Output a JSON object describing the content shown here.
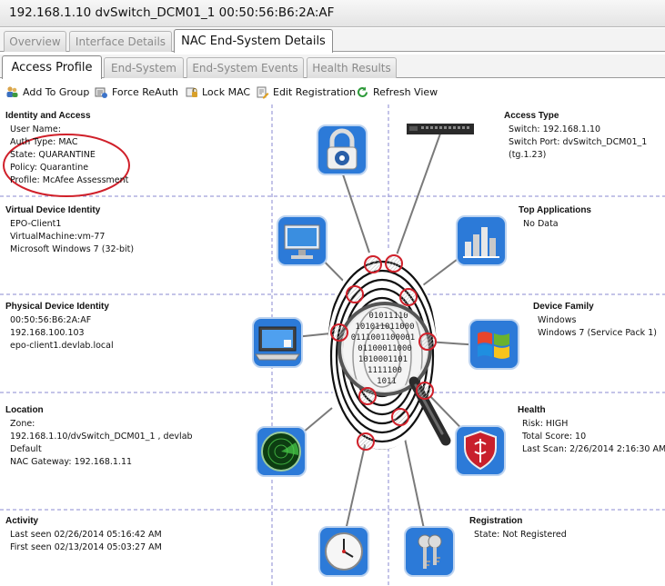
{
  "window": {
    "title": "192.168.1.10 dvSwitch_DCM01_1 00:50:56:B6:2A:AF"
  },
  "tabs_top": [
    {
      "label": "Overview",
      "active": false
    },
    {
      "label": "Interface Details",
      "active": false
    },
    {
      "label": "NAC End-System Details",
      "active": true
    }
  ],
  "tabs_sub": [
    {
      "label": "Access Profile",
      "active": true
    },
    {
      "label": "End-System",
      "active": false
    },
    {
      "label": "End-System Events",
      "active": false
    },
    {
      "label": "Health Results",
      "active": false
    }
  ],
  "toolbar": {
    "add_to_group": "Add To Group",
    "force_reauth": "Force ReAuth",
    "lock_mac": "Lock MAC",
    "edit_registration": "Edit Registration",
    "refresh_view": "Refresh View"
  },
  "sections": {
    "identity_access": {
      "title": "Identity and Access",
      "lines": [
        "User Name:",
        "Auth Type: MAC",
        "State: QUARANTINE",
        "Policy: Quarantine",
        "Profile: McAfee Assessment"
      ]
    },
    "virtual_device": {
      "title": "Virtual Device Identity",
      "lines": [
        "EPO-Client1",
        "VirtualMachine:vm-77",
        "Microsoft Windows 7 (32-bit)"
      ]
    },
    "physical_device": {
      "title": "Physical Device Identity",
      "lines": [
        "00:50:56:B6:2A:AF",
        "192.168.100.103",
        "epo-client1.devlab.local"
      ]
    },
    "location": {
      "title": "Location",
      "lines": [
        "Zone:",
        "192.168.1.10/dvSwitch_DCM01_1 , devlab",
        "Default",
        "NAC Gateway: 192.168.1.11"
      ]
    },
    "activity": {
      "title": "Activity",
      "lines": [
        "Last seen 02/26/2014 05:16:42 AM",
        "First seen 02/13/2014 05:03:27 AM"
      ]
    },
    "access_type": {
      "title": "Access Type",
      "lines": [
        "Switch: 192.168.1.10",
        "Switch Port: dvSwitch_DCM01_1",
        "(tg.1.23)"
      ]
    },
    "top_applications": {
      "title": "Top Applications",
      "lines": [
        "No Data"
      ]
    },
    "device_family": {
      "title": "Device Family",
      "lines": [
        "Windows",
        "Windows 7 (Service Pack 1)"
      ]
    },
    "health": {
      "title": "Health",
      "lines": [
        "Risk: HIGH",
        "Total Score: 10",
        "Last Scan: 2/26/2014 2:16:30 AM"
      ]
    },
    "registration": {
      "title": "Registration",
      "lines": [
        "State: Not Registered"
      ]
    }
  },
  "binary_text": [
    "01011110",
    "101011011000",
    "0111001100001",
    "01100011000",
    "1010001101",
    "1111100",
    "1011"
  ],
  "colors": {
    "annotation_red": "#d0202a",
    "dashed_divider": "#8a8ad0",
    "icon_blue": "#2b78d6"
  },
  "icons": [
    "padlock-icon",
    "monitor-icon",
    "laptop-icon",
    "radar-icon",
    "clock-icon",
    "network-switch-icon",
    "bar-chart-icon",
    "windows-logo-icon",
    "health-shield-icon",
    "keys-icon",
    "fingerprint-icon",
    "magnifier-icon"
  ]
}
